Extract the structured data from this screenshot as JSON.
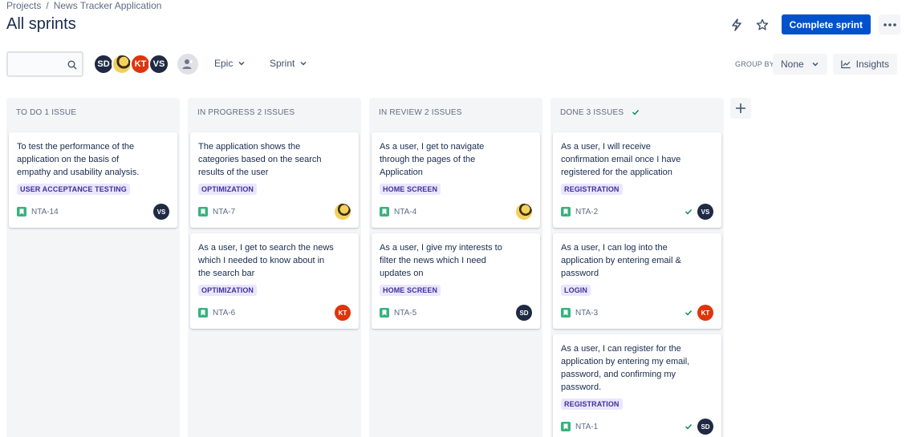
{
  "breadcrumb": {
    "root": "Projects",
    "separator": "/",
    "project": "News Tracker Application"
  },
  "page_title": "All sprints",
  "actions": {
    "complete_label": "Complete sprint",
    "bolt_icon": "lightning-icon",
    "star_icon": "star-icon",
    "more_icon": "more-icon"
  },
  "search": {
    "placeholder": "",
    "value": ""
  },
  "avatars": [
    {
      "initials": "SD",
      "color": "#1f2a44"
    },
    {
      "initials": "",
      "color": "#f1d05b"
    },
    {
      "initials": "KT",
      "color": "#de350b"
    },
    {
      "initials": "VS",
      "color": "#1f2a44"
    }
  ],
  "filters": {
    "epic": "Epic",
    "sprint": "Sprint"
  },
  "group_by": {
    "label": "GROUP BY",
    "value": "None"
  },
  "insights_label": "Insights",
  "columns": [
    {
      "header": "TO DO 1 ISSUE",
      "cards": [
        {
          "title": "To test the performance of the application on the basis of empathy and usability analysis.",
          "epic": "USER ACCEPTANCE TESTING",
          "key": "NTA-14",
          "assignee": "VS",
          "done": false
        }
      ]
    },
    {
      "header": "IN PROGRESS 2 ISSUES",
      "cards": [
        {
          "title": "The application shows the categories based on the search results of the user",
          "epic": "OPTIMIZATION",
          "key": "NTA-7",
          "assignee": "",
          "done": false
        },
        {
          "title": "As a user, I get to search the news which I needed to know about in the search bar",
          "epic": "OPTIMIZATION",
          "key": "NTA-6",
          "assignee": "KT",
          "done": false
        }
      ]
    },
    {
      "header": "IN REVIEW 2 ISSUES",
      "cards": [
        {
          "title": "As a user, I get to navigate through the pages of the Application",
          "epic": "HOME SCREEN",
          "key": "NTA-4",
          "assignee": "",
          "done": false
        },
        {
          "title": "As a user, I give my interests to filter the news which I need updates on",
          "epic": "HOME SCREEN",
          "key": "NTA-5",
          "assignee": "SD",
          "done": false
        }
      ]
    },
    {
      "header": "DONE 3 ISSUES",
      "cards": [
        {
          "title": "As a user, I will receive confirmation email once I have registered for the application",
          "epic": "REGISTRATION",
          "key": "NTA-2",
          "assignee": "VS",
          "done": true
        },
        {
          "title": "As a user, I can log into the application by entering email & password",
          "epic": "LOGIN",
          "key": "NTA-3",
          "assignee": "KT",
          "done": true
        },
        {
          "title": "As a user, I can register for the application by entering my email, password, and confirming my password.",
          "epic": "REGISTRATION",
          "key": "NTA-1",
          "assignee": "SD",
          "done": true
        }
      ]
    }
  ],
  "colors": {
    "primary": "#0052cc",
    "epic_bg": "#eae6ff",
    "epic_text": "#403294",
    "story": "#36b37e",
    "done_check": "#00875a"
  }
}
